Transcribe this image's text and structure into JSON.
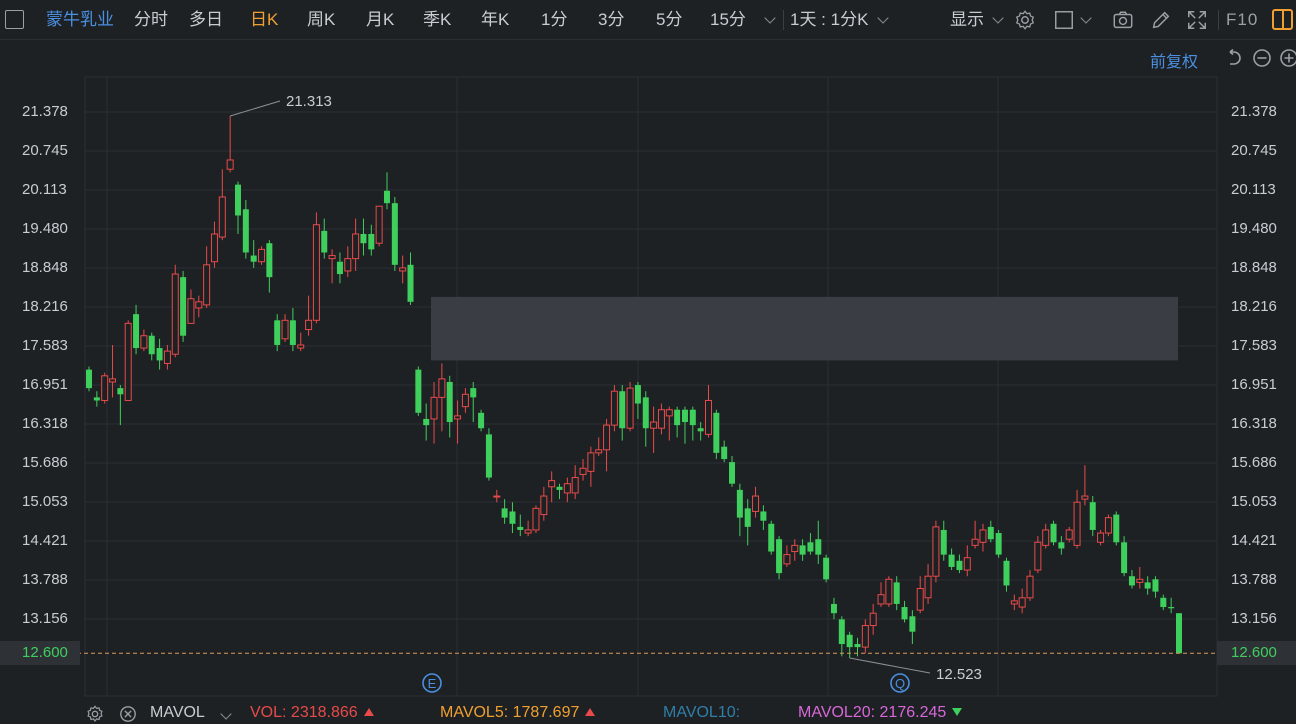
{
  "toolbar": {
    "stock_name": "蒙牛乳业",
    "periods": [
      "分时",
      "多日",
      "日K",
      "周K",
      "月K",
      "季K",
      "年K",
      "1分",
      "3分",
      "5分",
      "15分"
    ],
    "active_period": "日K",
    "range_label": "1天 : 1分K",
    "display_label": "显示",
    "f10_label": "F10",
    "icons": [
      "gear-icon",
      "square-icon",
      "camera-icon",
      "pen-icon",
      "expand-icon",
      "layout-icon"
    ],
    "accent_color": "#f0a030",
    "link_color": "#4a8fe0"
  },
  "subheader": {
    "adjust_label": "前复权",
    "icons": [
      "reset-icon",
      "zoom-out-icon",
      "zoom-in-icon"
    ]
  },
  "chart_data": {
    "type": "candlestick",
    "y_ticks": [
      "21.378",
      "20.745",
      "20.113",
      "19.480",
      "18.848",
      "18.216",
      "17.583",
      "16.951",
      "16.318",
      "15.686",
      "15.053",
      "14.421",
      "13.788",
      "13.156"
    ],
    "ylim": [
      12.3,
      21.9
    ],
    "current_price": "12.600",
    "high_annotation": "21.313",
    "low_annotation": "12.523",
    "event_markers": [
      "E",
      "Q"
    ],
    "up_color": "#e84a4a",
    "down_color": "#3fcf5c",
    "grid": true,
    "shaded_zone": {
      "from": 17.35,
      "to": 18.38
    },
    "candles": [
      [
        17.2,
        16.9,
        17.25,
        16.85
      ],
      [
        16.75,
        16.7,
        16.85,
        16.6
      ],
      [
        16.7,
        17.1,
        17.15,
        16.65
      ],
      [
        17.0,
        17.05,
        17.6,
        16.75
      ],
      [
        16.9,
        16.8,
        16.95,
        16.3
      ],
      [
        16.7,
        17.95,
        18.0,
        16.7
      ],
      [
        18.1,
        17.55,
        18.25,
        17.45
      ],
      [
        17.55,
        17.75,
        17.85,
        17.5
      ],
      [
        17.75,
        17.45,
        17.8,
        17.35
      ],
      [
        17.55,
        17.35,
        17.7,
        17.2
      ],
      [
        17.3,
        17.5,
        17.6,
        17.2
      ],
      [
        17.45,
        18.75,
        18.9,
        17.4
      ],
      [
        18.7,
        17.75,
        18.8,
        17.65
      ],
      [
        17.95,
        18.35,
        18.5,
        17.95
      ],
      [
        18.2,
        18.3,
        18.4,
        18.05
      ],
      [
        18.25,
        18.9,
        19.2,
        18.2
      ],
      [
        18.95,
        19.4,
        19.6,
        18.85
      ],
      [
        19.35,
        20.0,
        20.45,
        19.3
      ],
      [
        20.45,
        20.6,
        21.313,
        20.4
      ],
      [
        20.2,
        19.7,
        20.25,
        19.4
      ],
      [
        19.8,
        19.1,
        19.95,
        19.0
      ],
      [
        19.05,
        18.95,
        19.3,
        18.85
      ],
      [
        18.95,
        19.15,
        19.2,
        18.9
      ],
      [
        19.25,
        18.7,
        19.3,
        18.45
      ],
      [
        18.0,
        17.6,
        18.1,
        17.5
      ],
      [
        17.7,
        18.0,
        18.1,
        17.65
      ],
      [
        18.0,
        17.6,
        18.2,
        17.5
      ],
      [
        17.55,
        17.6,
        17.8,
        17.5
      ],
      [
        17.85,
        18.0,
        18.4,
        17.75
      ],
      [
        18.0,
        19.55,
        19.75,
        17.95
      ],
      [
        19.45,
        19.1,
        19.65,
        19.0
      ],
      [
        19.0,
        19.05,
        19.15,
        18.6
      ],
      [
        18.95,
        18.75,
        19.1,
        18.6
      ],
      [
        18.8,
        19.0,
        19.2,
        18.7
      ],
      [
        19.0,
        19.4,
        19.65,
        18.8
      ],
      [
        19.4,
        19.25,
        19.65,
        19.05
      ],
      [
        19.4,
        19.15,
        19.55,
        19.05
      ],
      [
        19.25,
        19.85,
        19.8,
        19.2
      ],
      [
        20.1,
        19.9,
        20.4,
        19.8
      ],
      [
        19.9,
        18.9,
        20.0,
        18.8
      ],
      [
        18.8,
        18.85,
        19.05,
        18.6
      ],
      [
        18.9,
        18.3,
        19.1,
        18.25
      ],
      [
        17.2,
        16.5,
        17.25,
        16.45
      ],
      [
        16.4,
        16.3,
        16.65,
        16.05
      ],
      [
        16.4,
        16.75,
        17.0,
        16.0
      ],
      [
        16.75,
        17.05,
        17.3,
        16.2
      ],
      [
        17.0,
        16.35,
        17.1,
        16.1
      ],
      [
        16.4,
        16.45,
        16.7,
        16.0
      ],
      [
        16.6,
        16.8,
        16.9,
        16.5
      ],
      [
        16.9,
        16.75,
        17.0,
        16.35
      ],
      [
        16.5,
        16.25,
        16.55,
        16.2
      ],
      [
        16.15,
        15.45,
        16.25,
        15.4
      ],
      [
        15.15,
        15.15,
        15.25,
        15.05
      ],
      [
        14.95,
        14.8,
        15.1,
        14.7
      ],
      [
        14.9,
        14.7,
        15.05,
        14.55
      ],
      [
        14.65,
        14.6,
        14.85,
        14.5
      ],
      [
        14.55,
        14.6,
        14.75,
        14.5
      ],
      [
        14.6,
        14.95,
        15.0,
        14.55
      ],
      [
        14.85,
        15.15,
        15.3,
        14.75
      ],
      [
        15.3,
        15.4,
        15.55,
        15.05
      ],
      [
        15.3,
        15.25,
        15.35,
        15.1
      ],
      [
        15.2,
        15.35,
        15.45,
        15.05
      ],
      [
        15.2,
        15.45,
        15.65,
        15.1
      ],
      [
        15.5,
        15.6,
        15.75,
        15.4
      ],
      [
        15.55,
        15.85,
        15.95,
        15.3
      ],
      [
        15.85,
        15.9,
        16.1,
        15.8
      ],
      [
        15.9,
        16.3,
        16.4,
        15.55
      ],
      [
        16.3,
        16.85,
        16.95,
        16.2
      ],
      [
        16.85,
        16.25,
        16.95,
        16.05
      ],
      [
        16.25,
        16.9,
        17.0,
        16.2
      ],
      [
        16.95,
        16.65,
        17.0,
        16.4
      ],
      [
        16.75,
        16.25,
        16.85,
        15.95
      ],
      [
        16.25,
        16.35,
        16.6,
        15.85
      ],
      [
        16.25,
        16.55,
        16.65,
        16.15
      ],
      [
        16.45,
        16.55,
        16.6,
        16.05
      ],
      [
        16.55,
        16.3,
        16.6,
        16.1
      ],
      [
        16.55,
        16.35,
        16.6,
        16.0
      ],
      [
        16.55,
        16.3,
        16.6,
        16.05
      ],
      [
        16.25,
        16.2,
        16.35,
        16.05
      ],
      [
        16.15,
        16.7,
        16.95,
        16.1
      ],
      [
        16.5,
        15.85,
        16.55,
        15.75
      ],
      [
        15.95,
        15.75,
        16.05,
        15.7
      ],
      [
        15.7,
        15.35,
        15.8,
        15.3
      ],
      [
        15.25,
        14.8,
        15.35,
        14.5
      ],
      [
        14.95,
        14.65,
        15.1,
        14.35
      ],
      [
        14.9,
        15.15,
        15.3,
        14.8
      ],
      [
        14.9,
        14.75,
        15.0,
        14.6
      ],
      [
        14.7,
        14.25,
        14.75,
        14.2
      ],
      [
        14.45,
        13.9,
        14.5,
        13.8
      ],
      [
        14.05,
        14.2,
        14.35,
        14.0
      ],
      [
        14.25,
        14.35,
        14.45,
        14.1
      ],
      [
        14.35,
        14.2,
        14.45,
        14.1
      ],
      [
        14.4,
        14.25,
        14.55,
        14.2
      ],
      [
        14.45,
        14.2,
        14.75,
        14.05
      ],
      [
        14.15,
        13.8,
        14.2,
        13.75
      ],
      [
        13.4,
        13.25,
        13.5,
        13.15
      ],
      [
        13.15,
        12.75,
        13.2,
        12.55
      ],
      [
        12.9,
        12.7,
        12.95,
        12.523
      ],
      [
        12.75,
        12.7,
        12.85,
        12.55
      ],
      [
        12.7,
        13.05,
        13.15,
        12.6
      ],
      [
        13.05,
        13.25,
        13.4,
        12.9
      ],
      [
        13.4,
        13.55,
        13.75,
        13.35
      ],
      [
        13.4,
        13.8,
        13.85,
        13.35
      ],
      [
        13.75,
        13.4,
        13.85,
        13.3
      ],
      [
        13.35,
        13.15,
        13.45,
        13.1
      ],
      [
        13.2,
        12.95,
        13.3,
        12.75
      ],
      [
        13.3,
        13.65,
        13.85,
        13.25
      ],
      [
        13.5,
        13.85,
        14.05,
        13.4
      ],
      [
        13.85,
        14.65,
        14.75,
        13.75
      ],
      [
        14.6,
        14.2,
        14.75,
        14.1
      ],
      [
        14.2,
        14.0,
        14.3,
        13.95
      ],
      [
        14.1,
        13.95,
        14.2,
        13.9
      ],
      [
        13.95,
        14.15,
        14.35,
        13.85
      ],
      [
        14.35,
        14.45,
        14.75,
        14.3
      ],
      [
        14.4,
        14.6,
        14.7,
        14.25
      ],
      [
        14.65,
        14.45,
        14.75,
        14.4
      ],
      [
        14.55,
        14.2,
        14.6,
        14.15
      ],
      [
        14.1,
        13.7,
        14.15,
        13.6
      ],
      [
        13.4,
        13.45,
        13.55,
        13.3
      ],
      [
        13.35,
        13.5,
        13.65,
        13.25
      ],
      [
        13.5,
        13.85,
        13.95,
        13.45
      ],
      [
        13.95,
        14.4,
        14.5,
        13.9
      ],
      [
        14.35,
        14.6,
        14.7,
        14.3
      ],
      [
        14.7,
        14.4,
        14.75,
        14.35
      ],
      [
        14.4,
        14.3,
        14.5,
        14.2
      ],
      [
        14.45,
        14.6,
        14.65,
        14.4
      ],
      [
        14.35,
        15.05,
        15.25,
        14.3
      ],
      [
        15.1,
        15.15,
        15.65,
        15.0
      ],
      [
        15.05,
        14.6,
        15.15,
        14.5
      ],
      [
        14.4,
        14.55,
        14.6,
        14.35
      ],
      [
        14.55,
        14.8,
        14.85,
        14.5
      ],
      [
        14.85,
        14.4,
        14.9,
        14.35
      ],
      [
        14.4,
        13.9,
        14.5,
        13.85
      ],
      [
        13.85,
        13.7,
        13.95,
        13.65
      ],
      [
        13.75,
        13.8,
        14.0,
        13.65
      ],
      [
        13.75,
        13.65,
        13.85,
        13.55
      ],
      [
        13.8,
        13.6,
        13.85,
        13.5
      ],
      [
        13.5,
        13.35,
        13.55,
        13.3
      ],
      [
        13.35,
        13.33,
        13.5,
        13.25
      ],
      [
        13.25,
        12.6,
        13.25,
        12.6
      ]
    ]
  },
  "indicator": {
    "name": "MAVOL",
    "vol_label": "VOL:",
    "vol_value": "2318.866",
    "mavol5_label": "MAVOL5:",
    "mavol5_value": "1787.697",
    "mavol10_label": "MAVOL10:",
    "mavol20_label": "MAVOL20:",
    "mavol20_value": "2176.245"
  }
}
